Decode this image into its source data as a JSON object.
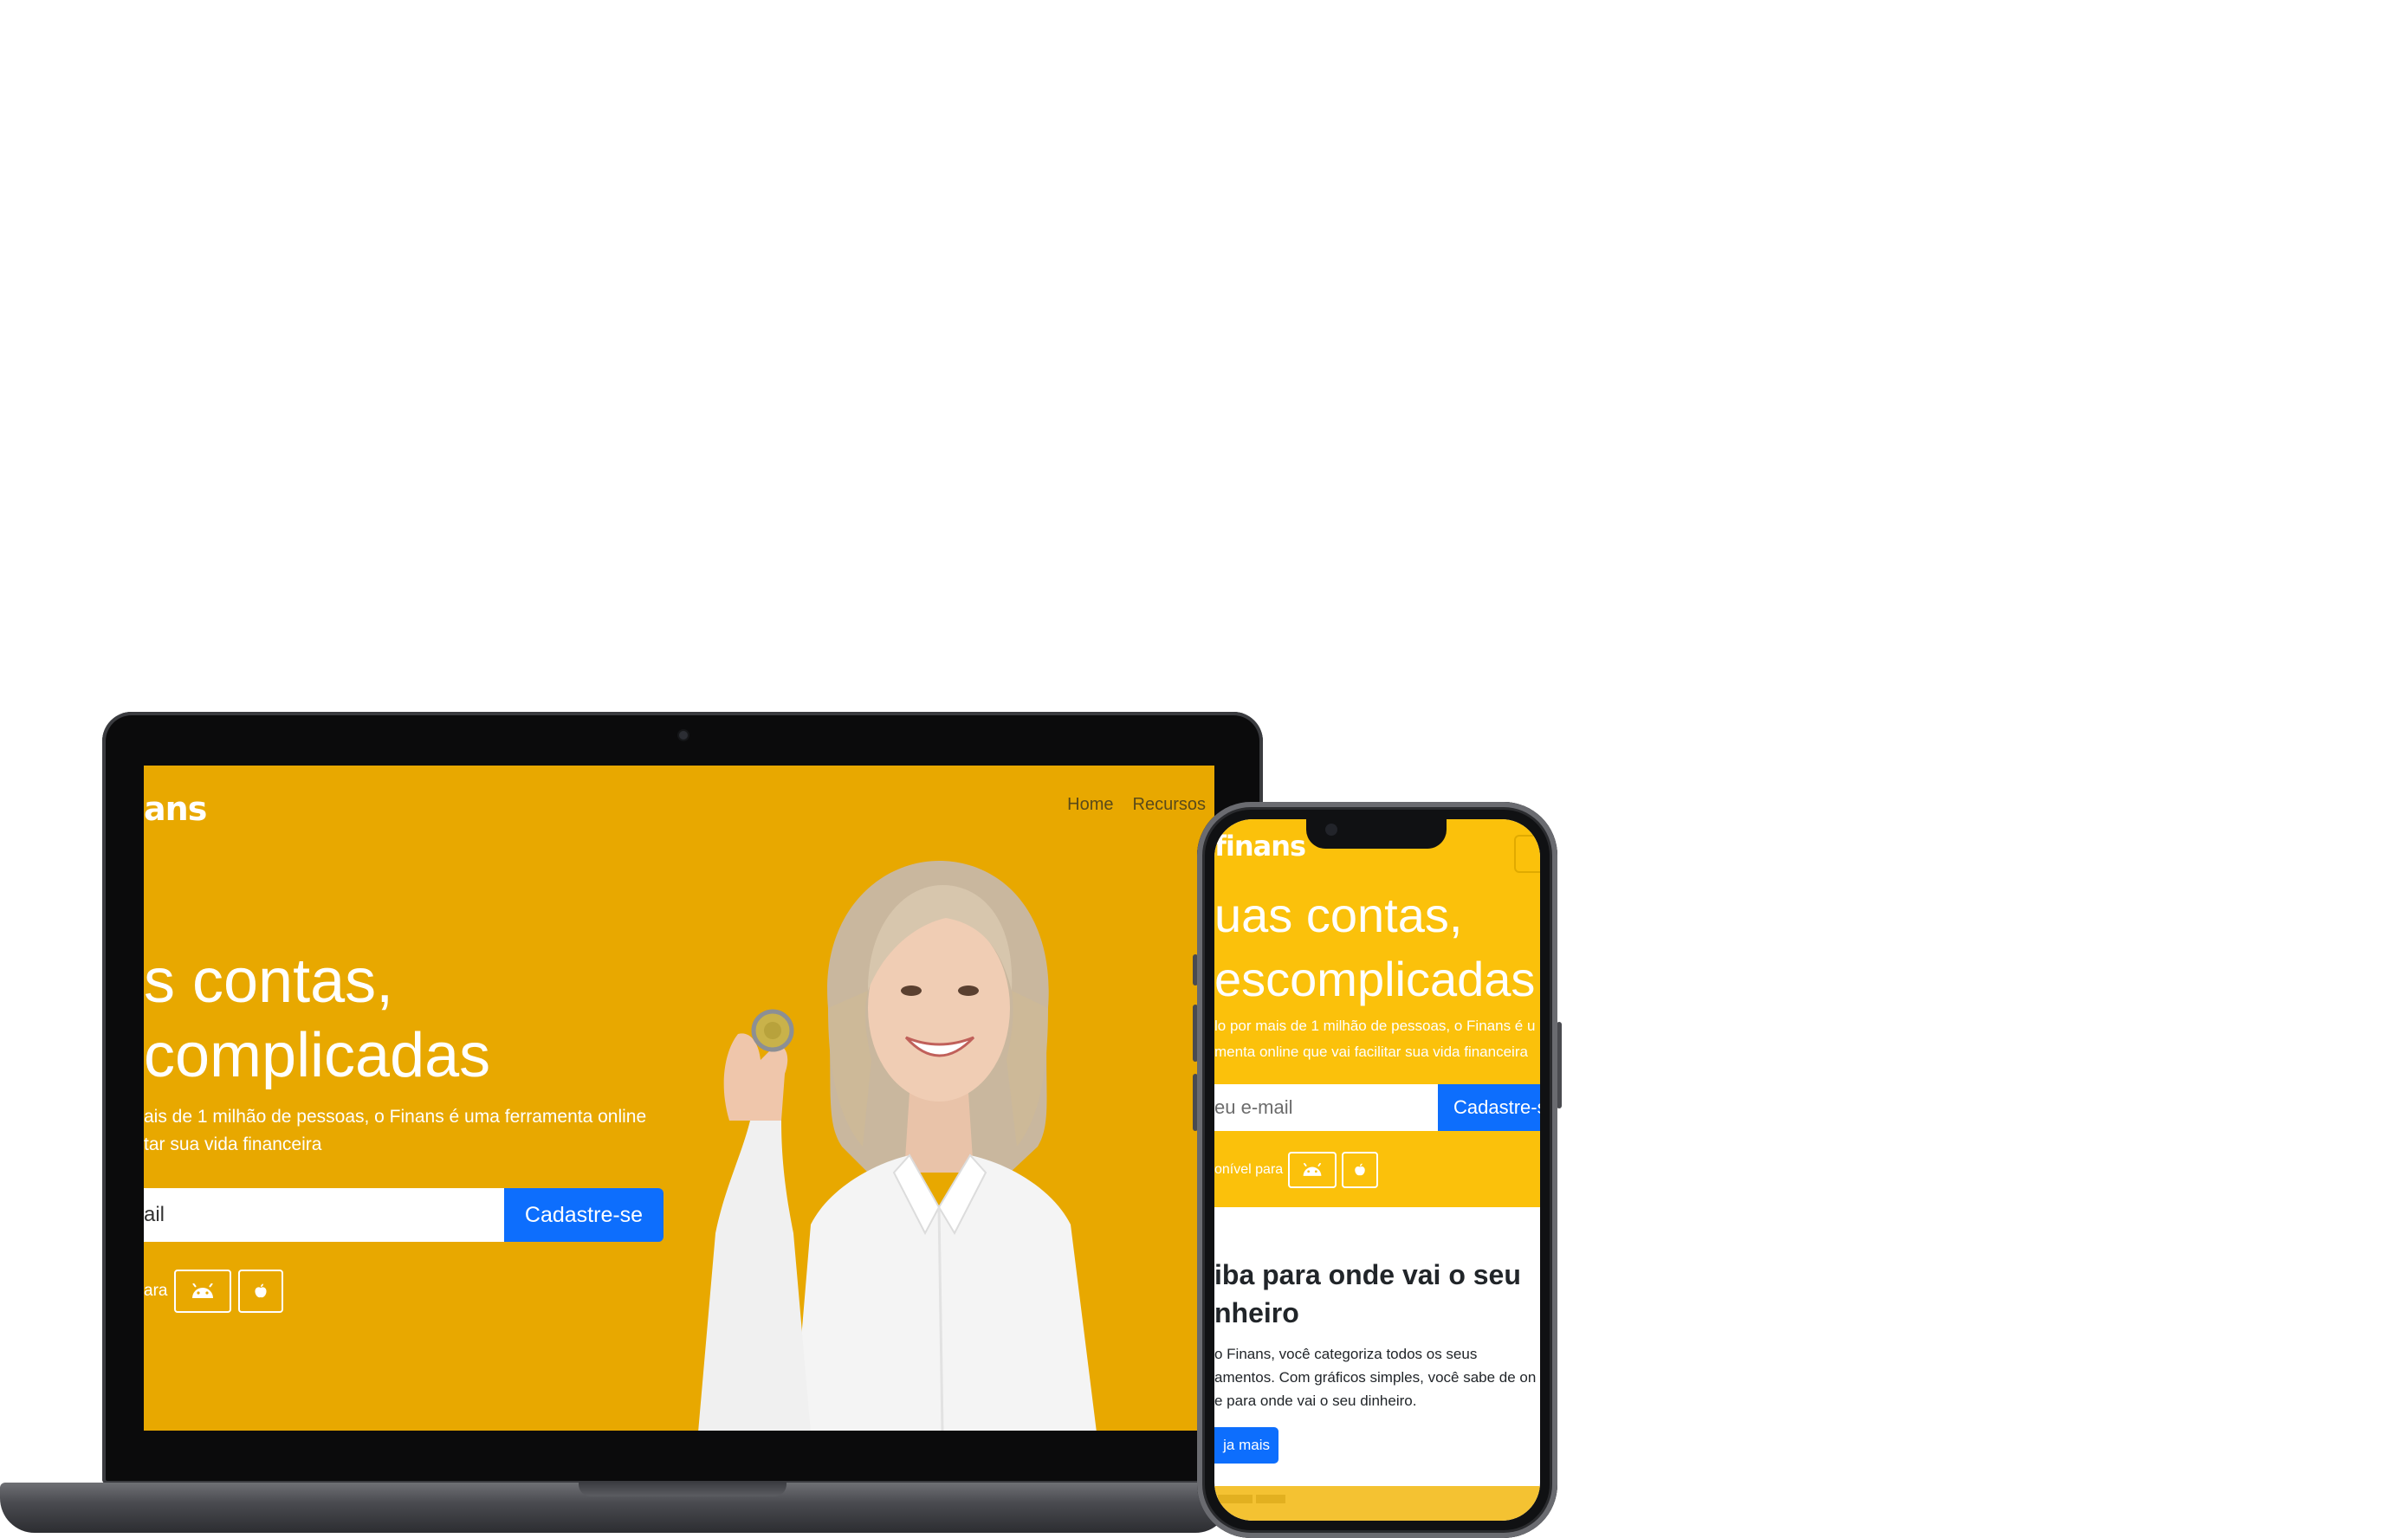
{
  "colors": {
    "laptop_hero_bg": "#e8a800",
    "phone_hero_bg": "#fbc10b",
    "primary_button": "#0d6efd",
    "text_white": "#ffffff"
  },
  "laptop": {
    "logo": "ans",
    "nav": {
      "home": "Home",
      "resources": "Recursos"
    },
    "headline": {
      "line1": "s contas,",
      "line2": "complicadas"
    },
    "subtitle": {
      "line1": "ais de 1 milhão de pessoas, o Finans é uma ferramenta online",
      "line2": "tar sua vida financeira"
    },
    "email_placeholder": "ail",
    "signup_button": "Cadastre-se",
    "available_text": "ara",
    "icons": {
      "android": "android-icon",
      "apple": "apple-icon"
    }
  },
  "phone": {
    "logo": "finans",
    "headline": {
      "line1": "uas contas,",
      "line2": "escomplicadas"
    },
    "subtitle": {
      "line1": "lo por mais de 1 milhão de pessoas, o Finans é u",
      "line2": "menta online que vai facilitar sua vida financeira"
    },
    "email_placeholder": "eu e-mail",
    "signup_button": "Cadastre-s",
    "available_text": "onível para",
    "section": {
      "title_line1": "iba para onde vai o seu",
      "title_line2": "nheiro",
      "text_line1": "o Finans, você categoriza todos os seus",
      "text_line2": "amentos. Com gráficos simples, você sabe de on",
      "text_line3": "e para onde vai o seu dinheiro.",
      "more_button": "ja mais"
    },
    "icons": {
      "android": "android-icon",
      "apple": "apple-icon",
      "menu": "hamburger-menu-icon"
    }
  }
}
